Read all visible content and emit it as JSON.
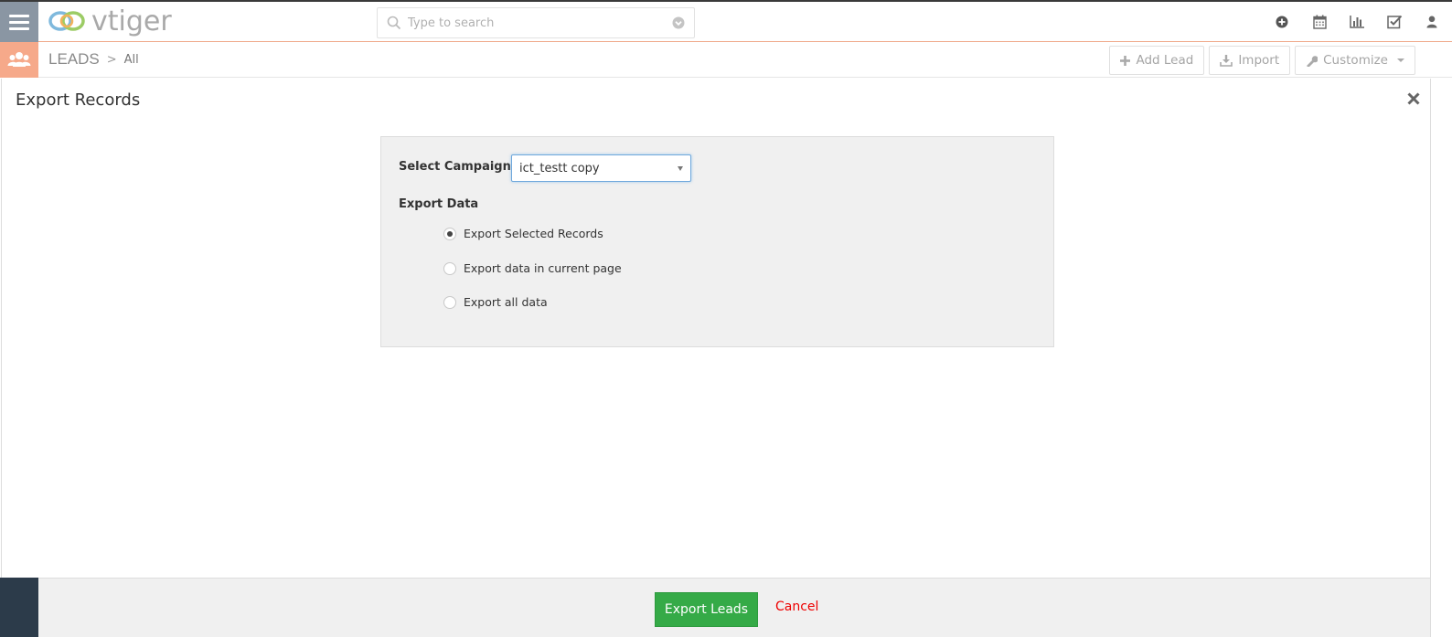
{
  "app": {
    "logo_text": "vtiger"
  },
  "search": {
    "placeholder": "Type to search"
  },
  "top_icons": [
    "plus-circle-icon",
    "calendar-icon",
    "bar-chart-icon",
    "check-square-icon",
    "user-icon"
  ],
  "module": {
    "name": "LEADS",
    "view": "All"
  },
  "actions": {
    "add_label": "Add Lead",
    "import_label": "Import",
    "customize_label": "Customize"
  },
  "modal": {
    "title": "Export Records",
    "campaign_label": "Select Campaign",
    "campaign_value": "ict_testt copy",
    "export_data_label": "Export Data",
    "options": [
      {
        "label": "Export Selected Records",
        "selected": true
      },
      {
        "label": "Export data in current page",
        "selected": false
      },
      {
        "label": "Export all data",
        "selected": false
      }
    ]
  },
  "footer": {
    "export_label": "Export Leads",
    "cancel_label": "Cancel"
  },
  "colors": {
    "accent": "#f6a98a",
    "export_btn": "#35aa47",
    "cancel": "#e00000",
    "sidebar_dark": "#2c3b4a"
  }
}
